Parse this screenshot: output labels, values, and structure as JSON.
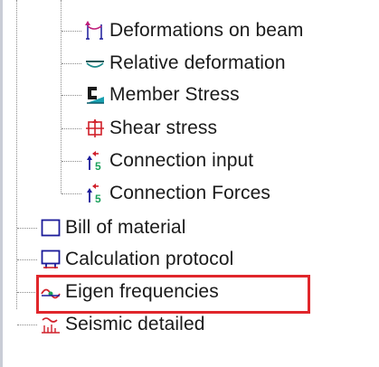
{
  "tree": {
    "items": [
      {
        "label": "Deformations on beam",
        "icon": "deformation-beam-icon"
      },
      {
        "label": "Relative deformation",
        "icon": "relative-deformation-icon"
      },
      {
        "label": "Member Stress",
        "icon": "member-stress-icon"
      },
      {
        "label": "Shear stress",
        "icon": "shear-stress-icon"
      },
      {
        "label": "Connection input",
        "icon": "connection-input-icon"
      },
      {
        "label": "Connection Forces",
        "icon": "connection-forces-icon"
      },
      {
        "label": "Bill of material",
        "icon": "bill-of-material-icon"
      },
      {
        "label": "Calculation protocol",
        "icon": "calculation-protocol-icon"
      },
      {
        "label": "Eigen frequencies",
        "icon": "eigen-frequencies-icon"
      },
      {
        "label": "Seismic detailed",
        "icon": "seismic-detailed-icon"
      }
    ],
    "highlight_color": "#e0262b"
  }
}
